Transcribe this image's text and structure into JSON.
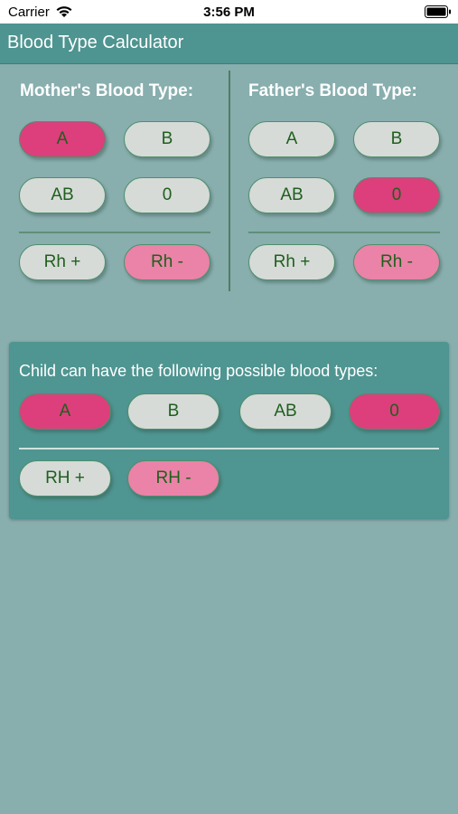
{
  "status_bar": {
    "carrier": "Carrier",
    "time": "3:56 PM"
  },
  "nav": {
    "title": "Blood Type Calculator"
  },
  "mother": {
    "title": "Mother's Blood Type:",
    "types": [
      "A",
      "B",
      "AB",
      "0"
    ],
    "selected_type": "A",
    "rh": [
      "Rh  +",
      "Rh -"
    ],
    "selected_rh": "Rh -"
  },
  "father": {
    "title": "Father's Blood Type:",
    "types": [
      "A",
      "B",
      "AB",
      "0"
    ],
    "selected_type": "0",
    "rh": [
      "Rh +",
      "Rh -"
    ],
    "selected_rh": "Rh -"
  },
  "result": {
    "title": "Child can have the following possible blood types:",
    "types": [
      "A",
      "B",
      "AB",
      "0"
    ],
    "highlighted_types": [
      "A",
      "0"
    ],
    "rh": [
      "RH +",
      "RH -"
    ],
    "highlighted_rh": [
      "RH -"
    ]
  },
  "colors": {
    "background": "#88aeae",
    "nav": "#4e9490",
    "selected": "#dc3f7c",
    "selected_rh": "#ea83a7",
    "unselected": "#d6dbd8",
    "label_text": "#1f5f1d"
  }
}
